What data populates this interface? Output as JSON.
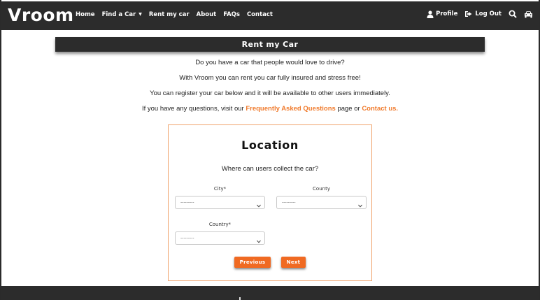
{
  "brand": "Vroom",
  "nav": {
    "links": [
      "Home",
      "Find a Car",
      "Rent my car",
      "About",
      "FAQs",
      "Contact"
    ],
    "profile": "Profile",
    "logout": "Log Out",
    "icons": [
      "user-icon",
      "logout-icon",
      "search-icon",
      "car-icon"
    ]
  },
  "page": {
    "title": "Rent my Car",
    "intro": [
      "Do you have a car that people would love to drive?",
      "With Vroom you can rent you car fully insured and stress free!",
      "You can register your car below and it will be available to other users immediately."
    ],
    "faq_prefix": "If you have any questions, visit our ",
    "faq_link": "Frequently Asked Questions",
    "faq_middle": " page or ",
    "contact_link": "Contact us."
  },
  "form": {
    "heading": "Location",
    "subheading": "Where can users collect the car?",
    "city_label": "City*",
    "county_label": "County",
    "country_label": "Country*",
    "city_value": "---------",
    "county_value": "---------",
    "country_value": "---------",
    "previous": "Previous",
    "next": "Next"
  },
  "colors": {
    "accent": "#f06a22",
    "link": "#f07b2d",
    "dark": "#2c2c2c"
  }
}
